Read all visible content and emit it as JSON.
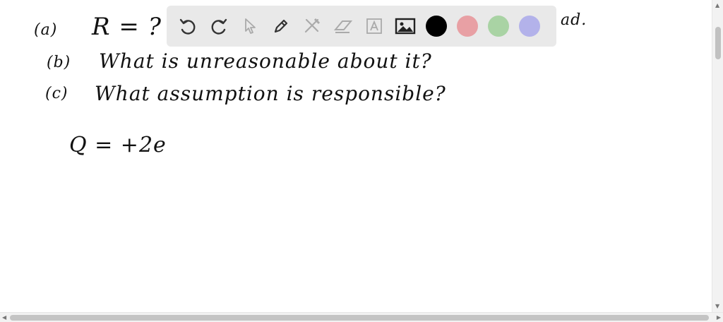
{
  "notes": {
    "line_a_label": "(a)",
    "line_a_text": "R = ?",
    "line_a_tail": "ad.",
    "line_b_label": "(b)",
    "line_b_text": "What is unreasonable about it?",
    "line_c_label": "(c)",
    "line_c_text": "What assumption is responsible?",
    "equation": "Q = +2e"
  },
  "toolbar": {
    "tools": [
      "undo-icon",
      "redo-icon",
      "pointer-icon",
      "pen-icon",
      "tools-icon",
      "eraser-icon",
      "text-icon",
      "image-icon"
    ],
    "colors": [
      "#000000",
      "#e8a0a4",
      "#a9d3a4",
      "#b3b2ea"
    ]
  },
  "scrollbars": {
    "vertical_arrow_up": "▲",
    "vertical_arrow_down": "▼",
    "horizontal_arrow_left": "◀",
    "horizontal_arrow_right": "▶"
  }
}
